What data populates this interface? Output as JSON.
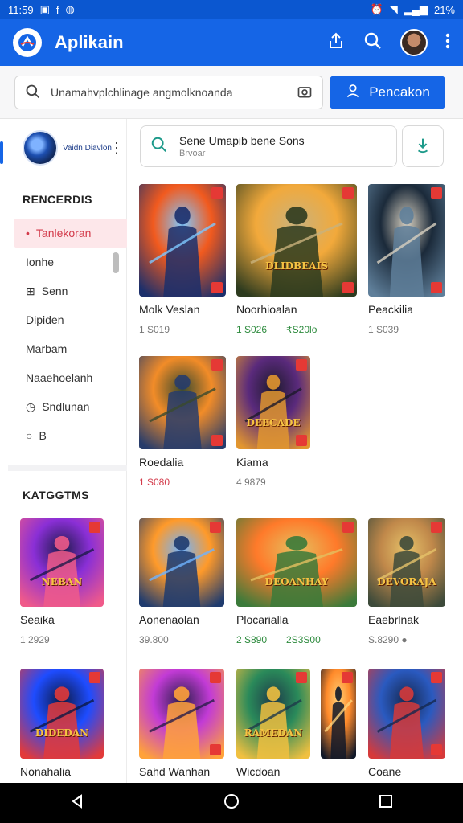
{
  "status_bar": {
    "time": "11:59",
    "battery": "21%"
  },
  "app": {
    "title": "Aplikain"
  },
  "search": {
    "placeholder": "Unamahvplchlinage angmolknoanda",
    "button_label": "Pencakon"
  },
  "sidebar": {
    "profile_name": "Vaidn Diavlon",
    "recent_title": "RENCERDIS",
    "menu": [
      {
        "label": "Tanlekoran",
        "icon": "dot-icon",
        "active": true
      },
      {
        "label": "Ionhe",
        "icon": "",
        "active": false
      },
      {
        "label": "Senn",
        "icon": "gamepad-icon",
        "active": false
      },
      {
        "label": "Dipiden",
        "icon": "",
        "active": false
      },
      {
        "label": "Marbam",
        "icon": "",
        "active": false
      },
      {
        "label": "Naaehoelanh",
        "icon": "",
        "active": false
      },
      {
        "label": "Sndlunan",
        "icon": "clock-icon",
        "active": false
      },
      {
        "label": "B",
        "icon": "circle-icon",
        "active": false
      }
    ],
    "categories_title": "KATGGTMS"
  },
  "content_search": {
    "title": "Sene Umapib bene Sons",
    "subtitle": "Brvoar"
  },
  "games": [
    {
      "title": "Molk Veslan",
      "meta": [
        "1 S019"
      ],
      "palette": [
        "#f25a1e",
        "#1c2f6b",
        "#7ec8ff"
      ]
    },
    {
      "title": "Noorhioalan",
      "meta": [
        "1 S026",
        "₹S20lo"
      ],
      "palette": [
        "#f2a93b",
        "#2d3b1f",
        "#c9b27c"
      ]
    },
    {
      "title": "Peackilia",
      "meta": [
        "1 S039"
      ],
      "palette": [
        "#1b2a3a",
        "#5f7f9a",
        "#d8d0c0"
      ]
    },
    {
      "title": "Roedalia",
      "meta": [
        "1 S080"
      ],
      "palette": [
        "#f28c28",
        "#273c6b",
        "#3a4a2e"
      ]
    },
    {
      "title": "Kiama",
      "meta": [
        "4 9879"
      ],
      "palette": [
        "#5a2a7c",
        "#e2962f",
        "#1d1a2b"
      ]
    },
    {
      "title": "Seaika",
      "meta": [
        "1 2929"
      ],
      "palette": [
        "#8a2fd6",
        "#f05a8a",
        "#1e1a4a"
      ]
    },
    {
      "title": "Aonenaolan",
      "meta": [
        "39.800"
      ],
      "palette": [
        "#ff9a2a",
        "#1f3b6e",
        "#6fb3ff"
      ]
    },
    {
      "title": "Plocarialla",
      "meta": [
        "2 S890",
        "2S3S00"
      ],
      "palette": [
        "#ff7a2a",
        "#3b7a3a",
        "#e4c060"
      ]
    },
    {
      "title": "Eaebrlnak",
      "meta": [
        "S.8290 ●"
      ],
      "palette": [
        "#c0884a",
        "#3d4a3a",
        "#e6c36a"
      ]
    },
    {
      "title": "Nonahalia",
      "meta": [],
      "palette": [
        "#1e4cff",
        "#e23a3a",
        "#0d1a44"
      ]
    },
    {
      "title": "Sahd Wanhan",
      "meta": [],
      "palette": [
        "#c23bd6",
        "#ffa23a",
        "#2a1e4a"
      ]
    },
    {
      "title": "Wicdoan",
      "meta": [],
      "palette": [
        "#2a8a5a",
        "#f0c040",
        "#1e3a4a"
      ]
    },
    {
      "title": "Coane",
      "meta": [],
      "palette": [
        "#2a5ac0",
        "#d63a3a",
        "#16284e"
      ]
    }
  ],
  "thumb_captions": {
    "g2": "DLIDBEAIS",
    "g5": "DEECADE",
    "g6": "NEBAN",
    "g8": "DEOANHAY",
    "g9": "DEVORAJA",
    "g10": "DIDEDAN",
    "g12": "RAMEDAN"
  }
}
